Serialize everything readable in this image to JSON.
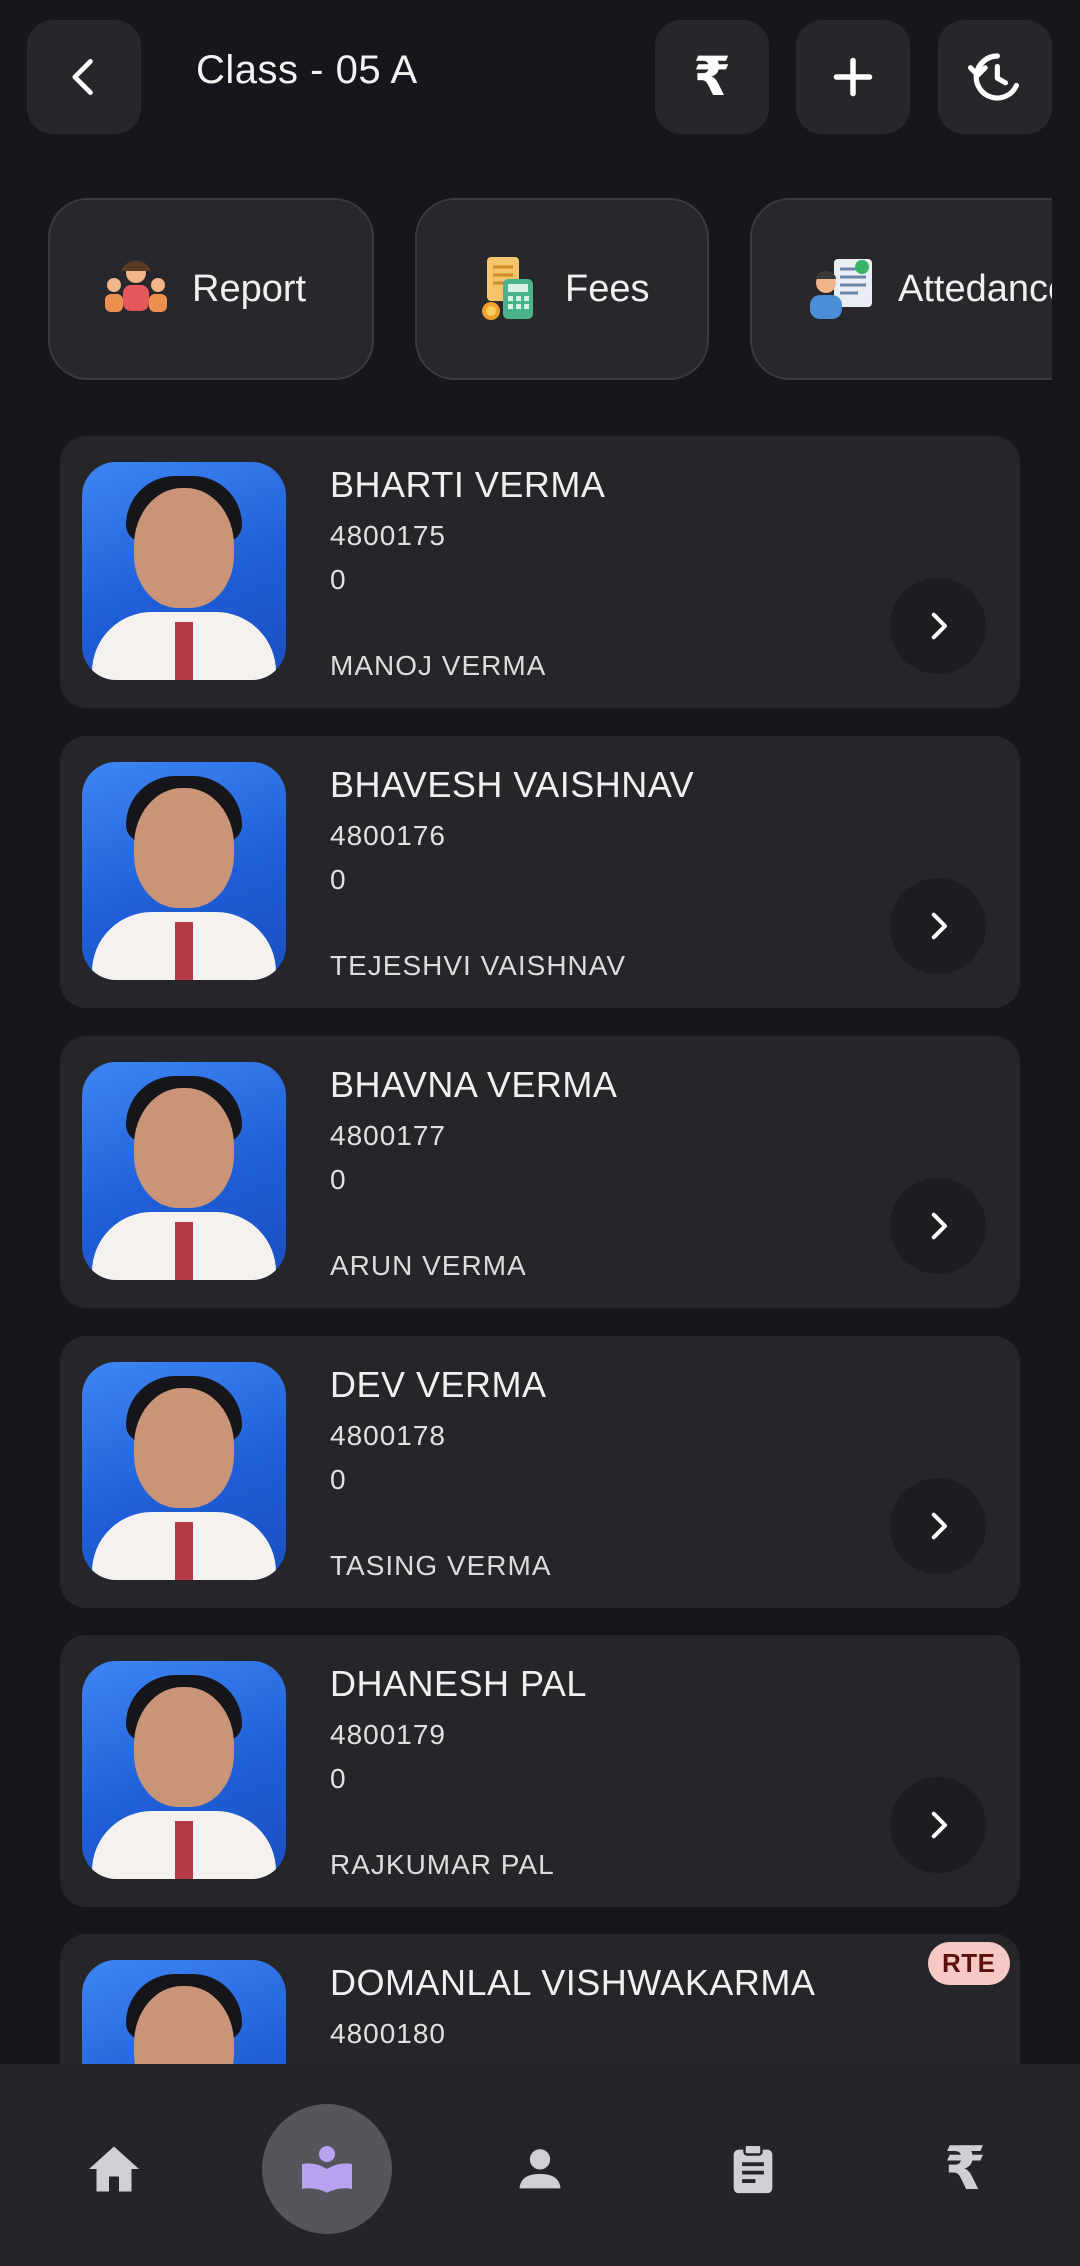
{
  "header": {
    "title": "Class - 05  A",
    "back_icon": "back-arrow-icon",
    "rupee_icon": "rupee-icon",
    "rupee_symbol": "₹",
    "add_icon": "plus-icon",
    "history_icon": "history-icon"
  },
  "quick_actions": [
    {
      "label": "Report",
      "icon": "students-group-icon"
    },
    {
      "label": "Fees",
      "icon": "fees-calculator-icon"
    },
    {
      "label": "Attedance",
      "icon": "attendance-icon"
    }
  ],
  "students": [
    {
      "name": "BHARTI VERMA",
      "id": "4800175",
      "value": "0",
      "parent": "MANOJ VERMA",
      "badge": ""
    },
    {
      "name": "BHAVESH VAISHNAV",
      "id": "4800176",
      "value": "0",
      "parent": "TEJESHVI VAISHNAV",
      "badge": ""
    },
    {
      "name": "BHAVNA VERMA",
      "id": "4800177",
      "value": "0",
      "parent": "ARUN VERMA",
      "badge": ""
    },
    {
      "name": "DEV VERMA",
      "id": "4800178",
      "value": "0",
      "parent": "TASING VERMA",
      "badge": ""
    },
    {
      "name": "DHANESH PAL",
      "id": "4800179",
      "value": "0",
      "parent": "RAJKUMAR PAL",
      "badge": ""
    },
    {
      "name": "DOMANLAL VISHWAKARMA",
      "id": "4800180",
      "value": "",
      "parent": "",
      "badge": "RTE"
    }
  ],
  "bottom_nav": {
    "items": [
      {
        "icon": "home-icon"
      },
      {
        "icon": "class-book-icon",
        "active": true
      },
      {
        "icon": "profile-icon"
      },
      {
        "icon": "clipboard-icon"
      },
      {
        "icon": "rupee-icon"
      }
    ],
    "rupee_symbol": "₹"
  },
  "colors": {
    "background": "#16161c",
    "card": "#26262a",
    "accent": "#b9a3f0",
    "badge_bg": "#f7c9c4"
  }
}
